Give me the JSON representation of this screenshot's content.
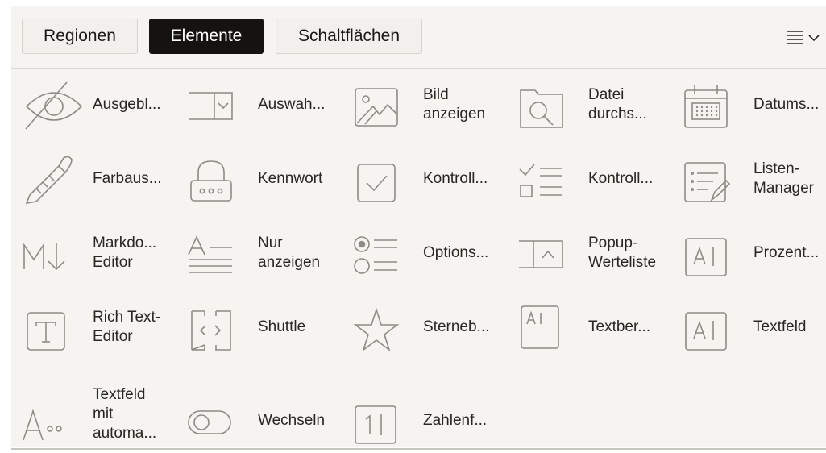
{
  "tabs": [
    {
      "label": "Regionen",
      "active": false
    },
    {
      "label": "Elemente",
      "active": true
    },
    {
      "label": "Schaltflächen",
      "active": false
    }
  ],
  "menu": {
    "icon": "hamburger-dropdown-icon"
  },
  "items": [
    {
      "label": "Ausgebl...",
      "icon": "eye-slash-icon"
    },
    {
      "label": "Auswah...",
      "icon": "select-list-icon"
    },
    {
      "label": "Bild\nanzeigen",
      "icon": "image-icon"
    },
    {
      "label": "Datei\ndurchs...",
      "icon": "file-browse-icon"
    },
    {
      "label": "Datums...",
      "icon": "calendar-icon"
    },
    {
      "label": "Farbaus...",
      "icon": "color-picker-icon"
    },
    {
      "label": "Kennwort",
      "icon": "password-icon"
    },
    {
      "label": "Kontroll...",
      "icon": "checkbox-icon"
    },
    {
      "label": "Kontroll...",
      "icon": "checklist-icon"
    },
    {
      "label": "Listen-\nManager",
      "icon": "list-manager-icon"
    },
    {
      "label": "Markdo...\nEditor",
      "icon": "markdown-icon"
    },
    {
      "label": "Nur\nanzeigen",
      "icon": "display-only-icon"
    },
    {
      "label": "Options...",
      "icon": "radio-group-icon"
    },
    {
      "label": "Popup-\nWerteliste",
      "icon": "popup-lov-icon"
    },
    {
      "label": "Prozent...",
      "icon": "percent-graph-icon"
    },
    {
      "label": "Rich Text-\nEditor",
      "icon": "rich-text-icon"
    },
    {
      "label": "Shuttle",
      "icon": "shuttle-icon"
    },
    {
      "label": "Sterneb...",
      "icon": "star-icon"
    },
    {
      "label": "Textber...",
      "icon": "textarea-icon"
    },
    {
      "label": "Textfeld",
      "icon": "text-field-icon"
    },
    {
      "label": "Textfeld\nmit\nautoma...",
      "icon": "autocomplete-icon"
    },
    {
      "label": "Wechseln",
      "icon": "switch-icon"
    },
    {
      "label": "Zahlenf...",
      "icon": "number-field-icon"
    }
  ]
}
